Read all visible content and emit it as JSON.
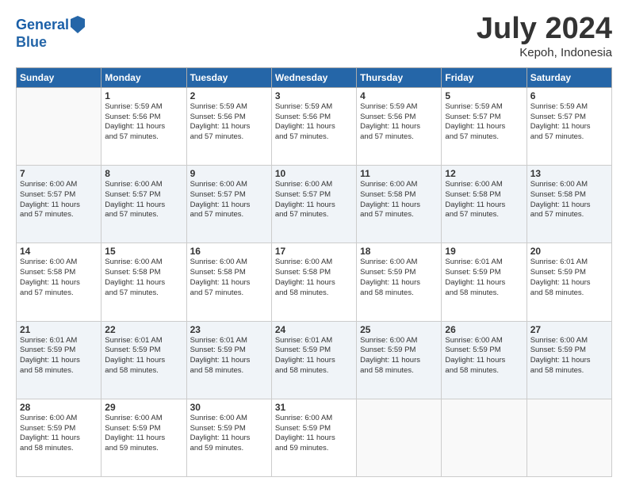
{
  "header": {
    "logo_line1": "General",
    "logo_line2": "Blue",
    "month_year": "July 2024",
    "location": "Kepoh, Indonesia"
  },
  "weekdays": [
    "Sunday",
    "Monday",
    "Tuesday",
    "Wednesday",
    "Thursday",
    "Friday",
    "Saturday"
  ],
  "weeks": [
    [
      {
        "day": "",
        "sunrise": "",
        "sunset": "",
        "daylight": ""
      },
      {
        "day": "1",
        "sunrise": "Sunrise: 5:59 AM",
        "sunset": "Sunset: 5:56 PM",
        "daylight": "Daylight: 11 hours and 57 minutes."
      },
      {
        "day": "2",
        "sunrise": "Sunrise: 5:59 AM",
        "sunset": "Sunset: 5:56 PM",
        "daylight": "Daylight: 11 hours and 57 minutes."
      },
      {
        "day": "3",
        "sunrise": "Sunrise: 5:59 AM",
        "sunset": "Sunset: 5:56 PM",
        "daylight": "Daylight: 11 hours and 57 minutes."
      },
      {
        "day": "4",
        "sunrise": "Sunrise: 5:59 AM",
        "sunset": "Sunset: 5:56 PM",
        "daylight": "Daylight: 11 hours and 57 minutes."
      },
      {
        "day": "5",
        "sunrise": "Sunrise: 5:59 AM",
        "sunset": "Sunset: 5:57 PM",
        "daylight": "Daylight: 11 hours and 57 minutes."
      },
      {
        "day": "6",
        "sunrise": "Sunrise: 5:59 AM",
        "sunset": "Sunset: 5:57 PM",
        "daylight": "Daylight: 11 hours and 57 minutes."
      }
    ],
    [
      {
        "day": "7",
        "sunrise": "Sunrise: 6:00 AM",
        "sunset": "Sunset: 5:57 PM",
        "daylight": "Daylight: 11 hours and 57 minutes."
      },
      {
        "day": "8",
        "sunrise": "Sunrise: 6:00 AM",
        "sunset": "Sunset: 5:57 PM",
        "daylight": "Daylight: 11 hours and 57 minutes."
      },
      {
        "day": "9",
        "sunrise": "Sunrise: 6:00 AM",
        "sunset": "Sunset: 5:57 PM",
        "daylight": "Daylight: 11 hours and 57 minutes."
      },
      {
        "day": "10",
        "sunrise": "Sunrise: 6:00 AM",
        "sunset": "Sunset: 5:57 PM",
        "daylight": "Daylight: 11 hours and 57 minutes."
      },
      {
        "day": "11",
        "sunrise": "Sunrise: 6:00 AM",
        "sunset": "Sunset: 5:58 PM",
        "daylight": "Daylight: 11 hours and 57 minutes."
      },
      {
        "day": "12",
        "sunrise": "Sunrise: 6:00 AM",
        "sunset": "Sunset: 5:58 PM",
        "daylight": "Daylight: 11 hours and 57 minutes."
      },
      {
        "day": "13",
        "sunrise": "Sunrise: 6:00 AM",
        "sunset": "Sunset: 5:58 PM",
        "daylight": "Daylight: 11 hours and 57 minutes."
      }
    ],
    [
      {
        "day": "14",
        "sunrise": "Sunrise: 6:00 AM",
        "sunset": "Sunset: 5:58 PM",
        "daylight": "Daylight: 11 hours and 57 minutes."
      },
      {
        "day": "15",
        "sunrise": "Sunrise: 6:00 AM",
        "sunset": "Sunset: 5:58 PM",
        "daylight": "Daylight: 11 hours and 57 minutes."
      },
      {
        "day": "16",
        "sunrise": "Sunrise: 6:00 AM",
        "sunset": "Sunset: 5:58 PM",
        "daylight": "Daylight: 11 hours and 57 minutes."
      },
      {
        "day": "17",
        "sunrise": "Sunrise: 6:00 AM",
        "sunset": "Sunset: 5:58 PM",
        "daylight": "Daylight: 11 hours and 58 minutes."
      },
      {
        "day": "18",
        "sunrise": "Sunrise: 6:00 AM",
        "sunset": "Sunset: 5:59 PM",
        "daylight": "Daylight: 11 hours and 58 minutes."
      },
      {
        "day": "19",
        "sunrise": "Sunrise: 6:01 AM",
        "sunset": "Sunset: 5:59 PM",
        "daylight": "Daylight: 11 hours and 58 minutes."
      },
      {
        "day": "20",
        "sunrise": "Sunrise: 6:01 AM",
        "sunset": "Sunset: 5:59 PM",
        "daylight": "Daylight: 11 hours and 58 minutes."
      }
    ],
    [
      {
        "day": "21",
        "sunrise": "Sunrise: 6:01 AM",
        "sunset": "Sunset: 5:59 PM",
        "daylight": "Daylight: 11 hours and 58 minutes."
      },
      {
        "day": "22",
        "sunrise": "Sunrise: 6:01 AM",
        "sunset": "Sunset: 5:59 PM",
        "daylight": "Daylight: 11 hours and 58 minutes."
      },
      {
        "day": "23",
        "sunrise": "Sunrise: 6:01 AM",
        "sunset": "Sunset: 5:59 PM",
        "daylight": "Daylight: 11 hours and 58 minutes."
      },
      {
        "day": "24",
        "sunrise": "Sunrise: 6:01 AM",
        "sunset": "Sunset: 5:59 PM",
        "daylight": "Daylight: 11 hours and 58 minutes."
      },
      {
        "day": "25",
        "sunrise": "Sunrise: 6:00 AM",
        "sunset": "Sunset: 5:59 PM",
        "daylight": "Daylight: 11 hours and 58 minutes."
      },
      {
        "day": "26",
        "sunrise": "Sunrise: 6:00 AM",
        "sunset": "Sunset: 5:59 PM",
        "daylight": "Daylight: 11 hours and 58 minutes."
      },
      {
        "day": "27",
        "sunrise": "Sunrise: 6:00 AM",
        "sunset": "Sunset: 5:59 PM",
        "daylight": "Daylight: 11 hours and 58 minutes."
      }
    ],
    [
      {
        "day": "28",
        "sunrise": "Sunrise: 6:00 AM",
        "sunset": "Sunset: 5:59 PM",
        "daylight": "Daylight: 11 hours and 58 minutes."
      },
      {
        "day": "29",
        "sunrise": "Sunrise: 6:00 AM",
        "sunset": "Sunset: 5:59 PM",
        "daylight": "Daylight: 11 hours and 59 minutes."
      },
      {
        "day": "30",
        "sunrise": "Sunrise: 6:00 AM",
        "sunset": "Sunset: 5:59 PM",
        "daylight": "Daylight: 11 hours and 59 minutes."
      },
      {
        "day": "31",
        "sunrise": "Sunrise: 6:00 AM",
        "sunset": "Sunset: 5:59 PM",
        "daylight": "Daylight: 11 hours and 59 minutes."
      },
      {
        "day": "",
        "sunrise": "",
        "sunset": "",
        "daylight": ""
      },
      {
        "day": "",
        "sunrise": "",
        "sunset": "",
        "daylight": ""
      },
      {
        "day": "",
        "sunrise": "",
        "sunset": "",
        "daylight": ""
      }
    ]
  ]
}
